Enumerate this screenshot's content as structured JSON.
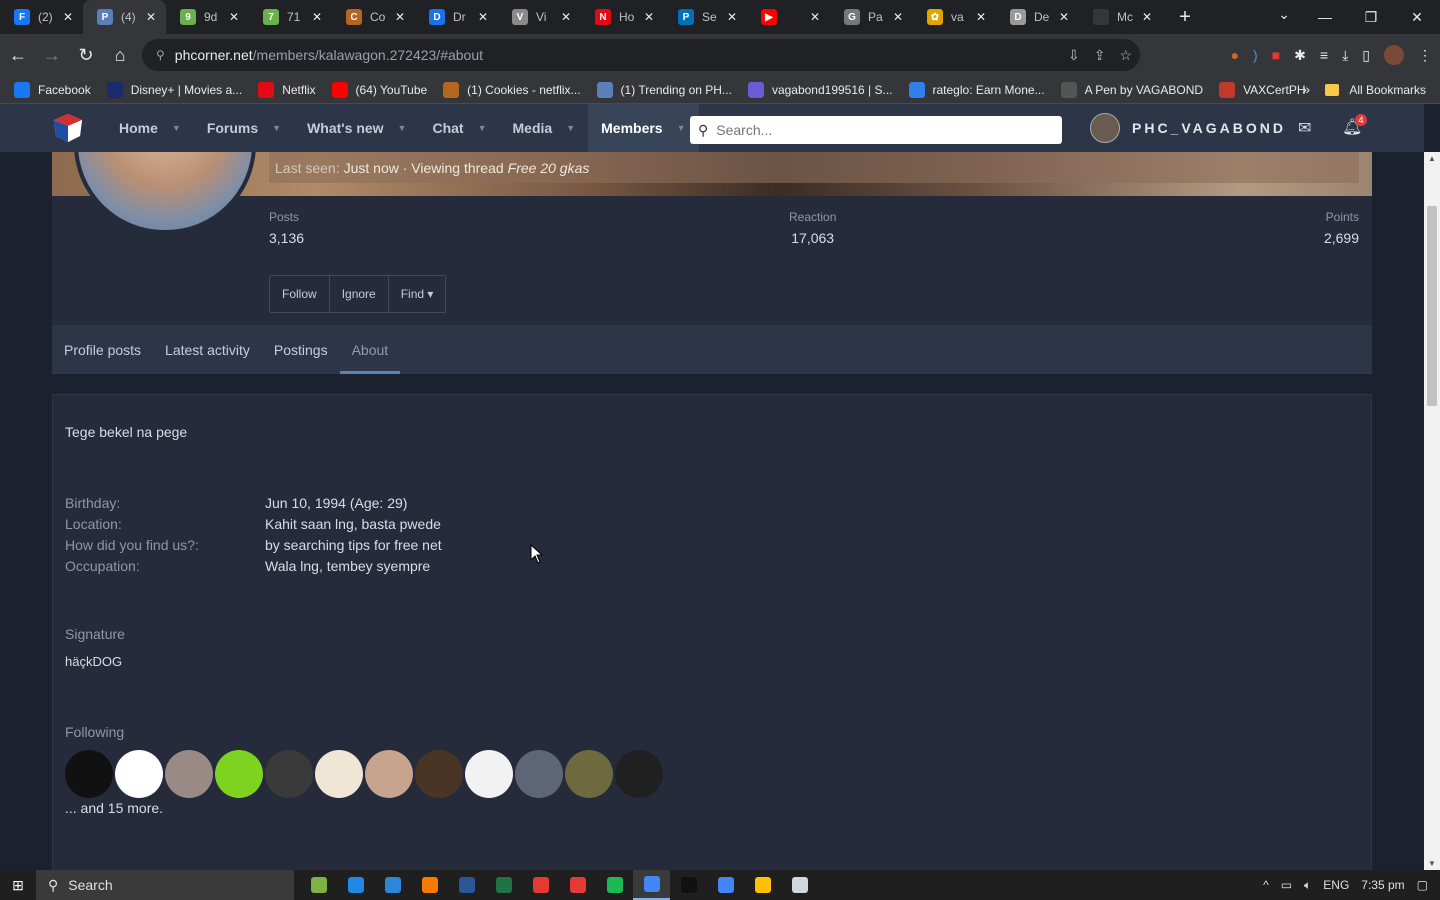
{
  "browser": {
    "tabs": [
      {
        "label": "(2)",
        "color": "#1877f2",
        "icon": "F"
      },
      {
        "label": "(4)",
        "color": "#5b7fb8",
        "icon": "P",
        "active": true
      },
      {
        "label": "9d",
        "color": "#6ab04c",
        "icon": "9"
      },
      {
        "label": "71",
        "color": "#6ab04c",
        "icon": "7"
      },
      {
        "label": "Co",
        "color": "#b5651d",
        "icon": "C"
      },
      {
        "label": "Dr",
        "color": "#1a73e8",
        "icon": "D"
      },
      {
        "label": "Vi",
        "color": "#8a8a8a",
        "icon": "V"
      },
      {
        "label": "Ho",
        "color": "#e50914",
        "icon": "N"
      },
      {
        "label": "Se",
        "color": "#0070ba",
        "icon": "P"
      },
      {
        "label": "",
        "color": "#ff0000",
        "icon": "▶"
      },
      {
        "label": "Pa",
        "color": "#777777",
        "icon": "G"
      },
      {
        "label": "va",
        "color": "#e0a400",
        "icon": "✿"
      },
      {
        "label": "De",
        "color": "#999999",
        "icon": "D"
      },
      {
        "label": "Mc",
        "color": "#35363a",
        "icon": ""
      }
    ],
    "url_host": "phcorner.net",
    "url_path": "/members/kalawagon.272423/#about",
    "bookmarks": [
      {
        "label": "Facebook",
        "color": "#1877f2"
      },
      {
        "label": "Disney+ | Movies a...",
        "color": "#1a2a6c"
      },
      {
        "label": "Netflix",
        "color": "#e50914"
      },
      {
        "label": "(64) YouTube",
        "color": "#ff0000"
      },
      {
        "label": "(1) Cookies - netflix...",
        "color": "#b5651d"
      },
      {
        "label": "(1) Trending on PH...",
        "color": "#5b7fb8"
      },
      {
        "label": "vagabond199516 | S...",
        "color": "#6b5bd6"
      },
      {
        "label": "rateglo: Earn Mone...",
        "color": "#2f80ed"
      },
      {
        "label": "A Pen by VAGABOND",
        "color": "#555555"
      },
      {
        "label": "VAXCertPH",
        "color": "#c0392b"
      }
    ],
    "bookmarks_more": "»",
    "all_bookmarks": "All Bookmarks"
  },
  "site": {
    "nav": [
      {
        "label": "Home",
        "selected": false
      },
      {
        "label": "Forums",
        "selected": false
      },
      {
        "label": "What's new",
        "selected": false
      },
      {
        "label": "Chat",
        "selected": false
      },
      {
        "label": "Media",
        "selected": false
      },
      {
        "label": "Members",
        "selected": true
      }
    ],
    "search_placeholder": "Search...",
    "username": "PHC_VAGABOND",
    "notification_count": "4"
  },
  "profile": {
    "last_seen_label": "Last seen:",
    "last_seen_value": "Just now · Viewing thread",
    "last_seen_thread": "Free 20 gkas",
    "stats": [
      {
        "label": "Posts",
        "value": "3,136"
      },
      {
        "label": "Reaction",
        "value": "17,063"
      },
      {
        "label": "Points",
        "value": "2,699"
      }
    ],
    "buttons": {
      "follow": "Follow",
      "ignore": "Ignore",
      "find": "Find ▾"
    },
    "tabs": [
      "Profile posts",
      "Latest activity",
      "Postings",
      "About"
    ],
    "active_tab": "About"
  },
  "about": {
    "text": "Tege bekel na pege",
    "fields": [
      {
        "label": "Birthday:",
        "value": "Jun 10, 1994 (Age: 29)"
      },
      {
        "label": "Location:",
        "value": "Kahit saan lng, basta pwede"
      },
      {
        "label": "How did you find us?:",
        "value": "by searching tips for free net"
      },
      {
        "label": "Occupation:",
        "value": "Wala lng, tembey syempre"
      }
    ],
    "signature_heading": "Signature",
    "signature": "häçkDOG",
    "following_heading": "Following",
    "following_colors": [
      "#111111",
      "#ffffff",
      "#9a8a86",
      "#7ed321",
      "#3a3a3a",
      "#f0e6d6",
      "#c7a48e",
      "#4a3426",
      "#f2f2f2",
      "#5d6577",
      "#6c6a3e",
      "#202020"
    ],
    "following_more": "... and 15 more."
  },
  "taskbar": {
    "search_label": "Search",
    "apps": [
      "#7cb342",
      "#1e88e5",
      "#2b88d8",
      "#f57c00",
      "#2b579a",
      "#217346",
      "#e53935",
      "#e53935",
      "#1db954",
      "#4285f4",
      "#111111",
      "#4285f4",
      "#ffc107",
      "#cfd8dc"
    ],
    "language": "ENG",
    "time": "7:35 pm"
  }
}
